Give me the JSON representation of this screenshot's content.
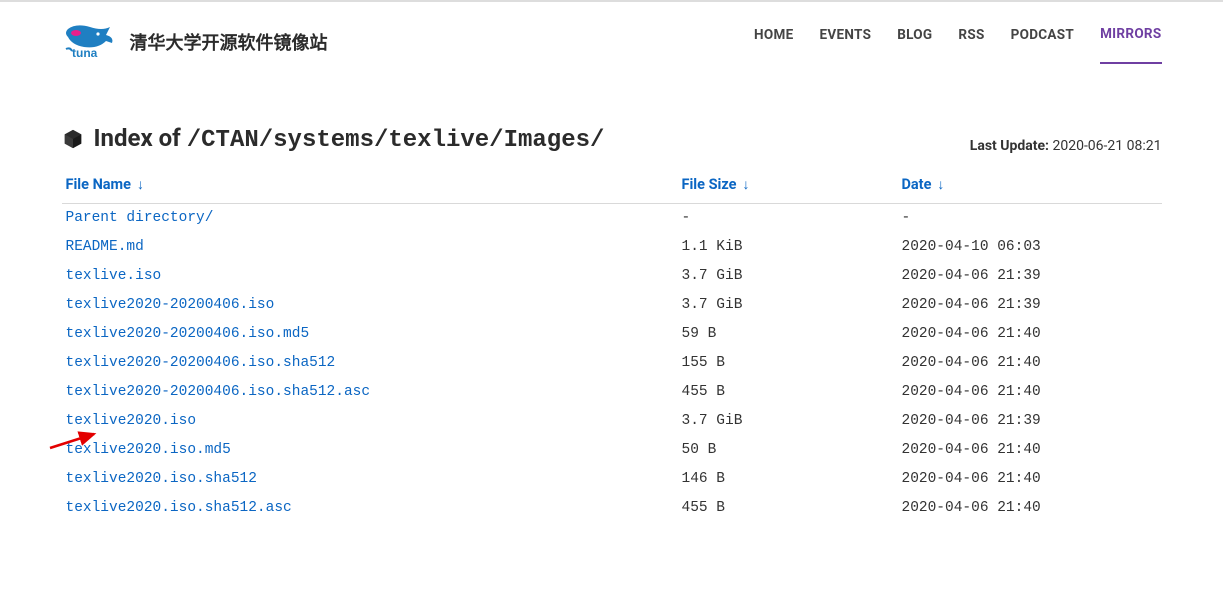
{
  "brand": {
    "title": "清华大学开源软件镜像站"
  },
  "nav": {
    "home": "HOME",
    "events": "EVENTS",
    "blog": "BLOG",
    "rss": "RSS",
    "podcast": "PODCAST",
    "mirrors": "MIRRORS"
  },
  "page": {
    "index_label": "Index of",
    "path": "/CTAN/systems/texlive/Images/",
    "last_update_label": "Last Update:",
    "last_update_value": "2020-06-21 08:21"
  },
  "columns": {
    "name": "File Name",
    "size": "File Size",
    "date": "Date",
    "sort_glyph": "↓"
  },
  "files": [
    {
      "name": "Parent directory/",
      "size": "-",
      "date": "-"
    },
    {
      "name": "README.md",
      "size": "1.1 KiB",
      "date": "2020-04-10 06:03"
    },
    {
      "name": "texlive.iso",
      "size": "3.7 GiB",
      "date": "2020-04-06 21:39"
    },
    {
      "name": "texlive2020-20200406.iso",
      "size": "3.7 GiB",
      "date": "2020-04-06 21:39"
    },
    {
      "name": "texlive2020-20200406.iso.md5",
      "size": "59 B",
      "date": "2020-04-06 21:40"
    },
    {
      "name": "texlive2020-20200406.iso.sha512",
      "size": "155 B",
      "date": "2020-04-06 21:40"
    },
    {
      "name": "texlive2020-20200406.iso.sha512.asc",
      "size": "455 B",
      "date": "2020-04-06 21:40"
    },
    {
      "name": "texlive2020.iso",
      "size": "3.7 GiB",
      "date": "2020-04-06 21:39"
    },
    {
      "name": "texlive2020.iso.md5",
      "size": "50 B",
      "date": "2020-04-06 21:40"
    },
    {
      "name": "texlive2020.iso.sha512",
      "size": "146 B",
      "date": "2020-04-06 21:40"
    },
    {
      "name": "texlive2020.iso.sha512.asc",
      "size": "455 B",
      "date": "2020-04-06 21:40"
    }
  ]
}
